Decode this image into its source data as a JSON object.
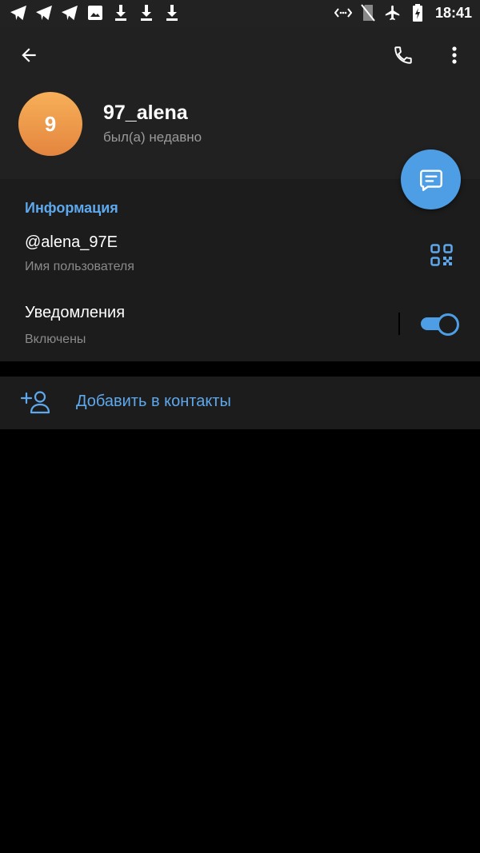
{
  "status_bar": {
    "time": "18:41",
    "left_icons": [
      "telegram-icon",
      "telegram-icon",
      "telegram-icon",
      "image-icon",
      "download-icon",
      "download-icon",
      "download-icon"
    ],
    "right_icons": [
      "data-saver-icon",
      "no-sim-icon",
      "airplane-icon",
      "battery-charging-icon"
    ]
  },
  "header": {
    "avatar_letter": "9",
    "name": "97_alena",
    "status": "был(а) недавно"
  },
  "info": {
    "section_title": "Информация",
    "username": "@alena_97E",
    "username_label": "Имя пользователя",
    "notifications": "Уведомления",
    "notifications_state": "Включены",
    "notifications_enabled": true
  },
  "actions": {
    "add_contact": "Добавить в контакты"
  },
  "colors": {
    "accent": "#5ea8ed",
    "fab": "#4e9ee5",
    "avatar_top": "#f7b058",
    "avatar_bottom": "#e4853f"
  }
}
